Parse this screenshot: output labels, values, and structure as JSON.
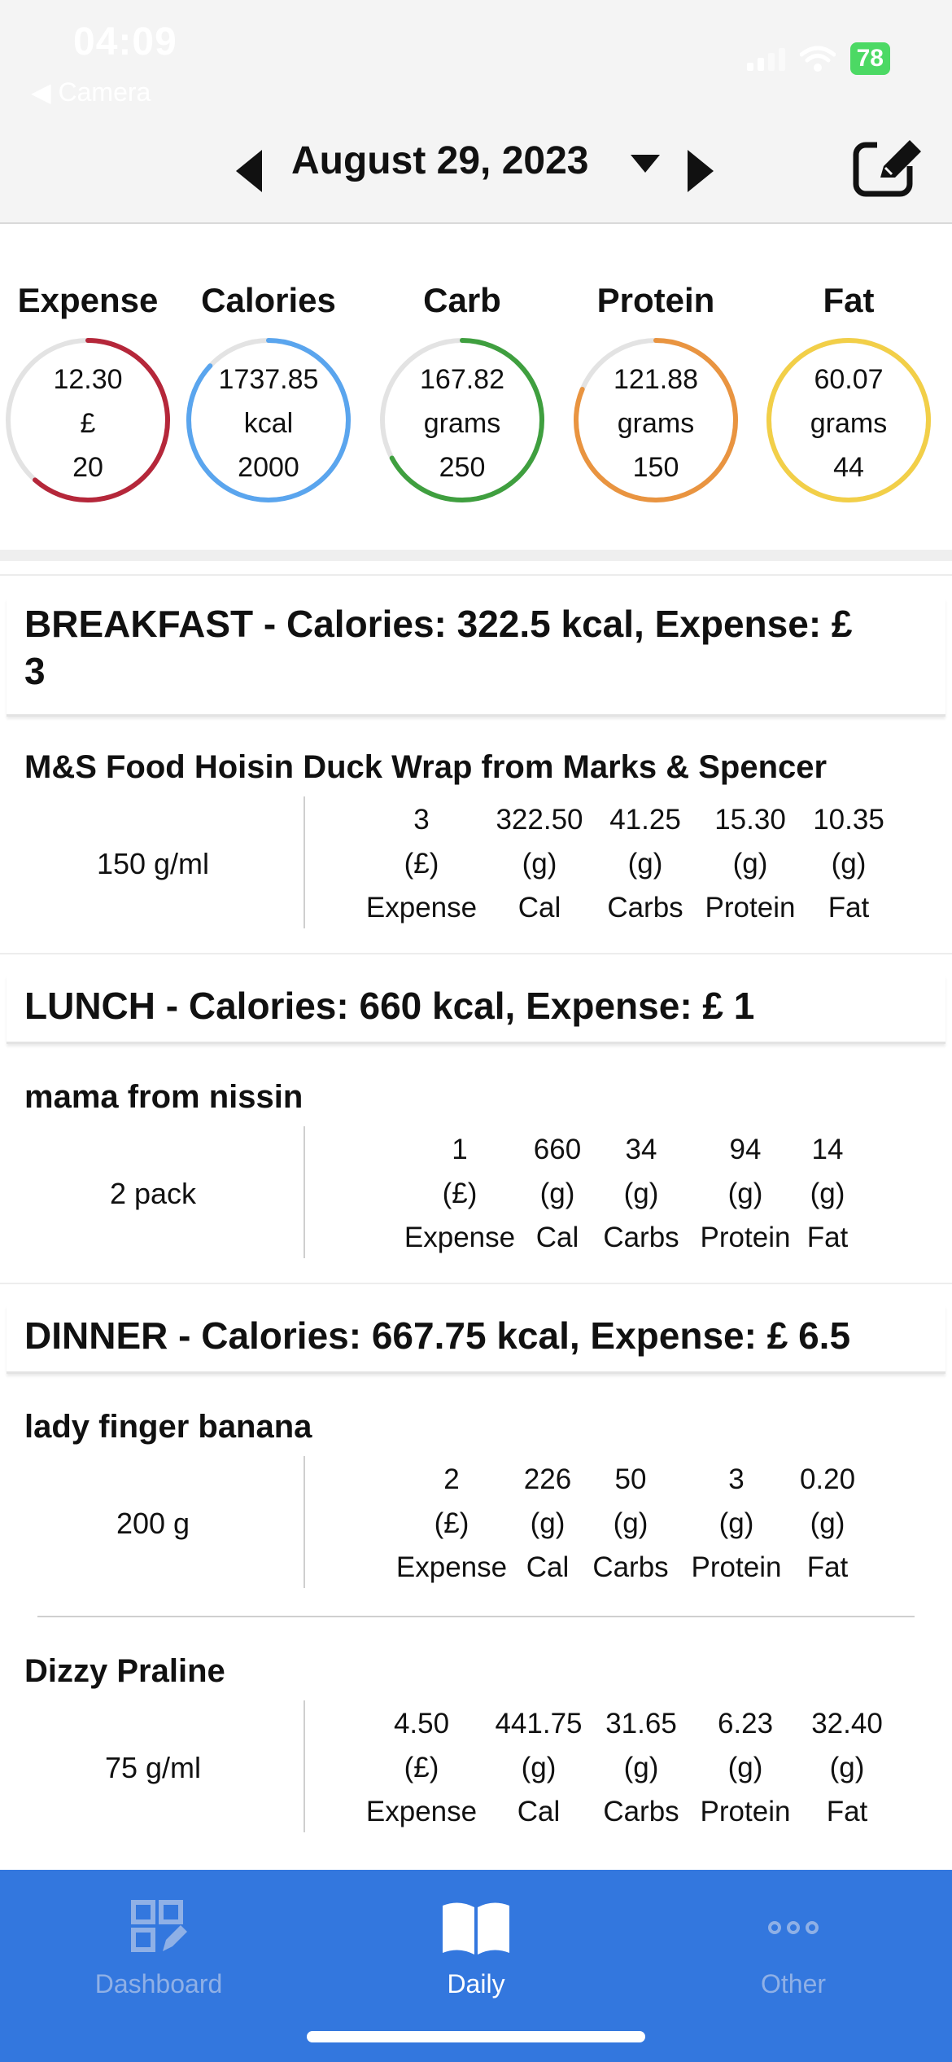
{
  "status": {
    "time": "04:09",
    "back_label": "◀ Camera",
    "battery": "78"
  },
  "header": {
    "date": "August 29, 2023"
  },
  "summary": [
    {
      "title": "Expense",
      "value": "12.30",
      "unit": "£",
      "target": "20",
      "progress": 0.615,
      "color": "#b5273a"
    },
    {
      "title": "Calories",
      "value": "1737.85",
      "unit": "kcal",
      "target": "2000",
      "progress": 0.869,
      "color": "#5aa5ee"
    },
    {
      "title": "Carb",
      "value": "167.82",
      "unit": "grams",
      "target": "250",
      "progress": 0.671,
      "color": "#3f9f3f"
    },
    {
      "title": "Protein",
      "value": "121.88",
      "unit": "grams",
      "target": "150",
      "progress": 0.813,
      "color": "#e99440"
    },
    {
      "title": "Fat",
      "value": "60.07",
      "unit": "grams",
      "target": "44",
      "progress": 1.0,
      "color": "#f2cf48"
    }
  ],
  "meals": {
    "breakfast": {
      "header_line1": "BREAKFAST - Calories: 322.5 kcal, Expense: £",
      "header_line2": "3",
      "items": [
        {
          "name": "M&S Food Hoisin Duck Wrap from Marks & Spencer",
          "qty": "150 g/ml",
          "macros": [
            {
              "value": "3",
              "unit": "(£)",
              "label": "Expense"
            },
            {
              "value": "322.50",
              "unit": "(g)",
              "label": "Cal"
            },
            {
              "value": "41.25",
              "unit": "(g)",
              "label": "Carbs"
            },
            {
              "value": "15.30",
              "unit": "(g)",
              "label": "Protein"
            },
            {
              "value": "10.35",
              "unit": "(g)",
              "label": "Fat"
            }
          ]
        }
      ]
    },
    "lunch": {
      "header": "LUNCH - Calories: 660 kcal, Expense: £ 1",
      "items": [
        {
          "name": "mama from nissin",
          "qty": "2 pack",
          "macros": [
            {
              "value": "1",
              "unit": "(£)",
              "label": "Expense"
            },
            {
              "value": "660",
              "unit": "(g)",
              "label": "Cal"
            },
            {
              "value": "34",
              "unit": "(g)",
              "label": "Carbs"
            },
            {
              "value": "94",
              "unit": "(g)",
              "label": "Protein"
            },
            {
              "value": "14",
              "unit": "(g)",
              "label": "Fat"
            }
          ]
        }
      ]
    },
    "dinner": {
      "header": "DINNER - Calories: 667.75 kcal, Expense: £ 6.5",
      "items": [
        {
          "name": "lady finger banana",
          "qty": "200 g",
          "macros": [
            {
              "value": "2",
              "unit": "(£)",
              "label": "Expense"
            },
            {
              "value": "226",
              "unit": "(g)",
              "label": "Cal"
            },
            {
              "value": "50",
              "unit": "(g)",
              "label": "Carbs"
            },
            {
              "value": "3",
              "unit": "(g)",
              "label": "Protein"
            },
            {
              "value": "0.20",
              "unit": "(g)",
              "label": "Fat"
            }
          ]
        },
        {
          "name": "Dizzy Praline",
          "qty": "75 g/ml",
          "macros": [
            {
              "value": "4.50",
              "unit": "(£)",
              "label": "Expense"
            },
            {
              "value": "441.75",
              "unit": "(g)",
              "label": "Cal"
            },
            {
              "value": "31.65",
              "unit": "(g)",
              "label": "Carbs"
            },
            {
              "value": "6.23",
              "unit": "(g)",
              "label": "Protein"
            },
            {
              "value": "32.40",
              "unit": "(g)",
              "label": "Fat"
            }
          ]
        }
      ]
    }
  },
  "tabbar": {
    "tabs": [
      {
        "label": "Dashboard",
        "icon": "dashboard-icon",
        "active": false
      },
      {
        "label": "Daily",
        "icon": "book-icon",
        "active": true
      },
      {
        "label": "Other",
        "icon": "more-dots-icon",
        "active": false
      }
    ],
    "active_color": "#ffffff",
    "inactive_color": "#8fb0e6"
  }
}
